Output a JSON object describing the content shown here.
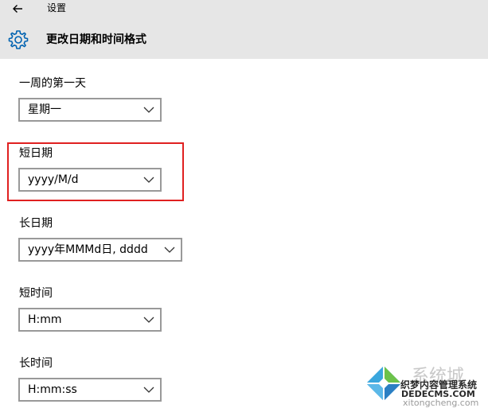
{
  "header": {
    "app_title": "设置",
    "page_title": "更改日期和时间格式",
    "back_icon": "arrow-left-icon",
    "settings_icon": "gear-icon"
  },
  "fields": [
    {
      "label": "一周的第一天",
      "value": "星期一"
    },
    {
      "label": "短日期",
      "value": "yyyy/M/d"
    },
    {
      "label": "长日期",
      "value": "yyyy年MMMd日, dddd"
    },
    {
      "label": "短时间",
      "value": "H:mm"
    },
    {
      "label": "长时间",
      "value": "H:mm:ss"
    }
  ],
  "watermark": {
    "text1": "系统城",
    "text2": "织梦内容管理系统",
    "text3": "DEDECMS.COM",
    "text4": "xitongcheng.com"
  },
  "colors": {
    "header_bg": "#e6e6e6",
    "accent": "#0063b1",
    "highlight": "#e02020",
    "dropdown_border": "#999999"
  }
}
